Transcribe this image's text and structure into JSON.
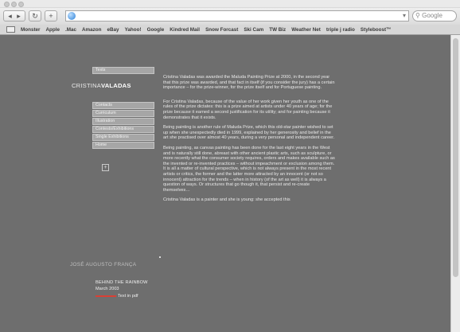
{
  "browser": {
    "nav": {
      "back": "◂",
      "forward": "▸",
      "reload": "↻",
      "add": "+"
    },
    "search_placeholder": "Google",
    "bookmarks": [
      "Monster",
      "Apple",
      ".Mac",
      "Amazon",
      "eBay",
      "Yahoo!",
      "Google",
      "Kindred Mail",
      "Snow Forcast",
      "Ski Cam",
      "TW Biz",
      "Weather Net",
      "triple j radio",
      "Styleboost™"
    ]
  },
  "site": {
    "brand_light": "CRISTINA",
    "brand_bold": "VALADAS",
    "top_button": "Texts",
    "menu": [
      "Contacts",
      "Curriculum",
      "Illustration",
      "Contests/Exhibitions",
      "Single Exhibitions",
      "Home"
    ],
    "plus": "+"
  },
  "article": {
    "paragraphs": [
      "Cristina Valadas was awarded the Maluda Painting Prize at 2000, in the second year that this prize was awarded, and that fact in itself (if you consider the jury) has a certain importance – for the prize-winner, for the prize itself and for Portuguese painting.",
      "For Cristina Valadas, because of the value of her work given her youth as one of the rules of the prize dictates: this is a prize aimed at artists under 40 years of age; for the prize because it earned a second justification for its utility; and for painting because it demonstrates that it exists.",
      "Being painting is another rule of Maluda Prize, which this old-star painter wished to set up when she unexpectedly died in 1999, explained by her generosity and belief in the art she practised over almost 40 years, during a very personal and independent career.",
      "Being painting, as canvas painting has been done for the last eight years in the West and is naturally still done, abreast with other ancient plastic arts, such as sculpture, or more recently what the consumer society requires, orders and makes available such as the invented or re-invented practices – without impeachment or exclusion among them. It is all a matter of cultural perspective, which is not always present in the most recent artists or critics, the former and the latter more attracted by an innocent (or not so innocent) attraction for the trends – when in history (of the art as well) it is always a question of ways. Or structures that go though it, that persist and re-create themselves…",
      "Cristina Valadas is a painter and she is young: she accepted this"
    ]
  },
  "footer": {
    "author": "JOSÉ AUGUSTO FRANÇA",
    "pub_title": "BEHIND THE RAINBOW",
    "pub_date": "March 2003",
    "pdf_label": "Text in pdf"
  }
}
